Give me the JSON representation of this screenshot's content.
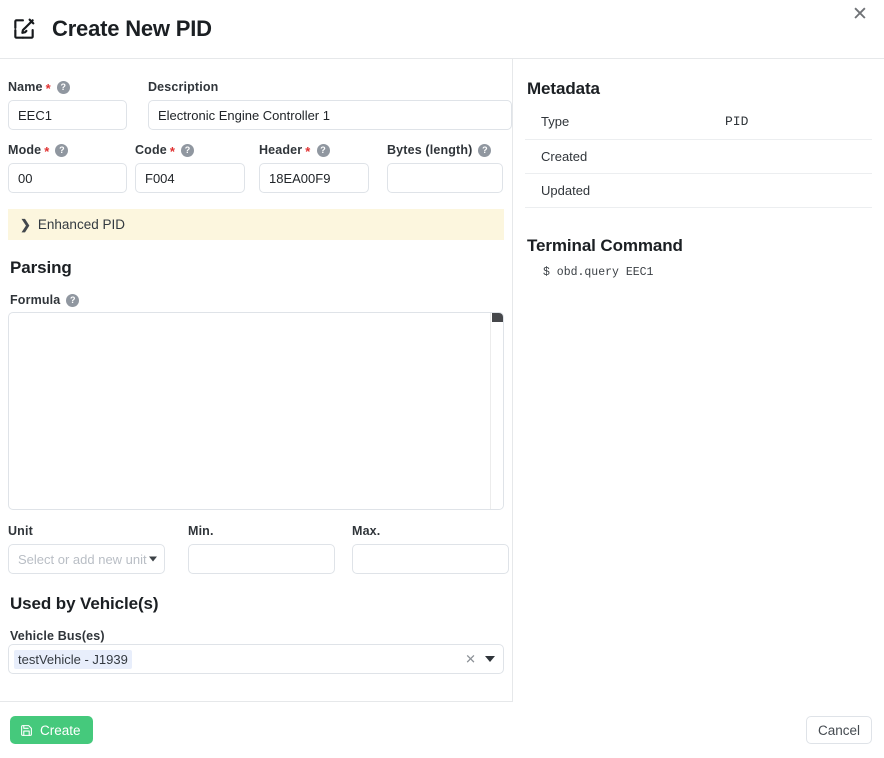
{
  "header": {
    "title": "Create New PID",
    "edit_icon": "edit-square-icon",
    "close_label": "✕"
  },
  "form": {
    "name": {
      "label": "Name",
      "required": true,
      "help": "?",
      "value": "EEC1",
      "placeholder": ""
    },
    "description": {
      "label": "Description",
      "required": false,
      "value": "Electronic Engine Controller 1",
      "placeholder": ""
    },
    "mode": {
      "label": "Mode",
      "required": true,
      "help": "?",
      "value": "00",
      "placeholder": ""
    },
    "code": {
      "label": "Code",
      "required": true,
      "help": "?",
      "value": "F004",
      "placeholder": ""
    },
    "header_field": {
      "label": "Header",
      "required": true,
      "help": "?",
      "value": "18EA00F9",
      "placeholder": ""
    },
    "bytes": {
      "label": "Bytes (length)",
      "required": false,
      "help": "?",
      "value": "",
      "placeholder": ""
    }
  },
  "enhanced_pid": {
    "label": "Enhanced PID",
    "chevron": "❯",
    "expanded": false,
    "background_color": "#fcf6de"
  },
  "parsing": {
    "section_title": "Parsing",
    "formula": {
      "label": "Formula",
      "help": "?",
      "value": ""
    },
    "unit": {
      "label": "Unit",
      "value": "",
      "placeholder": "Select or add new unit"
    },
    "min": {
      "label": "Min.",
      "value": "",
      "placeholder": ""
    },
    "max": {
      "label": "Max.",
      "value": "",
      "placeholder": ""
    }
  },
  "vehicles": {
    "section_title": "Used by Vehicle(s)",
    "bus_label": "Vehicle Bus(es)",
    "selected": [
      {
        "label": "testVehicle - J1939"
      }
    ],
    "clear_label": "✕",
    "chip_color": "#e8eefb"
  },
  "metadata": {
    "title": "Metadata",
    "rows": [
      {
        "key": "Type",
        "value": "PID"
      },
      {
        "key": "Created",
        "value": ""
      },
      {
        "key": "Updated",
        "value": ""
      }
    ]
  },
  "terminal": {
    "title": "Terminal Command",
    "command": "$ obd.query EEC1"
  },
  "footer": {
    "create_label": "Create",
    "create_icon": "save-floppy-icon",
    "create_color": "#45c97c",
    "cancel_label": "Cancel"
  }
}
